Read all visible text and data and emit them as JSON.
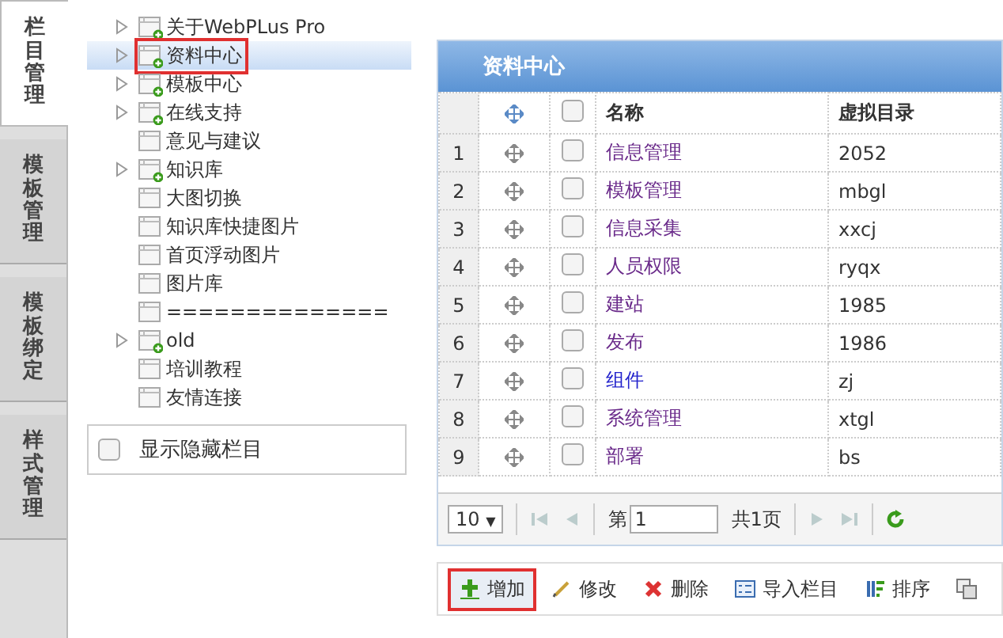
{
  "side_tabs": [
    {
      "label": "栏目管理",
      "selected": true
    },
    {
      "label": "模板管理",
      "selected": false
    },
    {
      "label": "模板绑定",
      "selected": false
    },
    {
      "label": "样式管理",
      "selected": false
    }
  ],
  "tree": {
    "items": [
      {
        "label": "关于WebPLus Pro",
        "expandable": true,
        "has_children_badge": true,
        "selected": false,
        "highlighted": false
      },
      {
        "label": "资料中心",
        "expandable": true,
        "has_children_badge": true,
        "selected": true,
        "highlighted": true
      },
      {
        "label": "模板中心",
        "expandable": true,
        "has_children_badge": true,
        "selected": false,
        "highlighted": false
      },
      {
        "label": "在线支持",
        "expandable": true,
        "has_children_badge": true,
        "selected": false,
        "highlighted": false
      },
      {
        "label": "意见与建议",
        "expandable": false,
        "has_children_badge": false,
        "selected": false,
        "highlighted": false
      },
      {
        "label": "知识库",
        "expandable": true,
        "has_children_badge": true,
        "selected": false,
        "highlighted": false
      },
      {
        "label": "大图切换",
        "expandable": false,
        "has_children_badge": false,
        "selected": false,
        "highlighted": false
      },
      {
        "label": "知识库快捷图片",
        "expandable": false,
        "has_children_badge": false,
        "selected": false,
        "highlighted": false
      },
      {
        "label": "首页浮动图片",
        "expandable": false,
        "has_children_badge": false,
        "selected": false,
        "highlighted": false
      },
      {
        "label": "图片库",
        "expandable": false,
        "has_children_badge": false,
        "selected": false,
        "highlighted": false
      },
      {
        "label": "==============",
        "expandable": false,
        "has_children_badge": false,
        "selected": false,
        "highlighted": false
      },
      {
        "label": "old",
        "expandable": true,
        "has_children_badge": true,
        "selected": false,
        "highlighted": false
      },
      {
        "label": "培训教程",
        "expandable": false,
        "has_children_badge": false,
        "selected": false,
        "highlighted": false
      },
      {
        "label": "友情连接",
        "expandable": false,
        "has_children_badge": false,
        "selected": false,
        "highlighted": false
      }
    ]
  },
  "show_hidden": {
    "label": "显示隐藏栏目",
    "checked": false
  },
  "panel": {
    "title": "资料中心",
    "columns": [
      "名称",
      "虚拟目录"
    ],
    "rows": [
      {
        "index": "1",
        "name": "信息管理",
        "directory": "2052",
        "visited": true,
        "checked": false
      },
      {
        "index": "2",
        "name": "模板管理",
        "directory": "mbgl",
        "visited": true,
        "checked": false
      },
      {
        "index": "3",
        "name": "信息采集",
        "directory": "xxcj",
        "visited": true,
        "checked": false
      },
      {
        "index": "4",
        "name": "人员权限",
        "directory": "ryqx",
        "visited": true,
        "checked": false
      },
      {
        "index": "5",
        "name": "建站",
        "directory": "1985",
        "visited": true,
        "checked": false
      },
      {
        "index": "6",
        "name": "发布",
        "directory": "1986",
        "visited": true,
        "checked": false
      },
      {
        "index": "7",
        "name": "组件",
        "directory": "zj",
        "visited": false,
        "checked": false
      },
      {
        "index": "8",
        "name": "系统管理",
        "directory": "xtgl",
        "visited": true,
        "checked": false
      },
      {
        "index": "9",
        "name": "部署",
        "directory": "bs",
        "visited": true,
        "checked": false
      }
    ],
    "select_all_checked": false,
    "pager": {
      "page_size": "10",
      "dropdown_arrow": "▼",
      "page_prefix": "第",
      "page": "1",
      "page_suffix": "共1页"
    }
  },
  "toolbar": [
    {
      "kind": "add",
      "label": "增加",
      "highlighted": true
    },
    {
      "kind": "edit",
      "label": "修改",
      "highlighted": false
    },
    {
      "kind": "delete",
      "label": "删除",
      "highlighted": false
    },
    {
      "kind": "import",
      "label": "导入栏目",
      "highlighted": false
    },
    {
      "kind": "sort",
      "label": "排序",
      "highlighted": false
    },
    {
      "kind": "move",
      "highlighted": false
    }
  ]
}
